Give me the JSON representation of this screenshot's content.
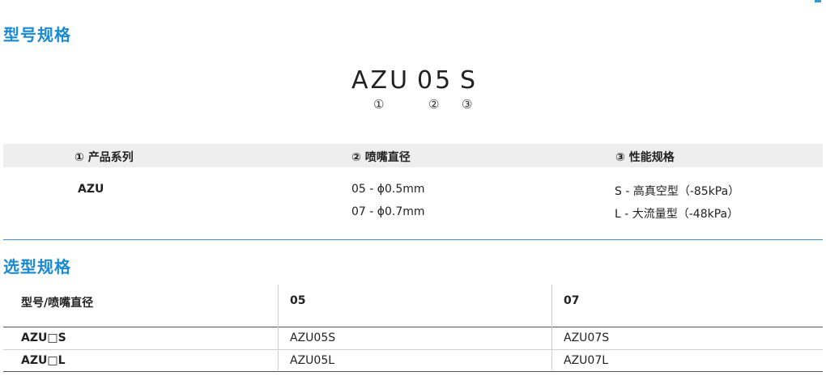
{
  "section1": {
    "title": "型号规格"
  },
  "code": {
    "series": "AZU",
    "diameter": "05",
    "spec": "S",
    "markers": [
      "①",
      "②",
      "③"
    ]
  },
  "spec_table": {
    "headers": [
      "① 产品系列",
      "② 喷嘴直径",
      "③ 性能规格"
    ],
    "series_values": [
      "AZU"
    ],
    "diameter_values": [
      "05 - ϕ0.5mm",
      "07 - ϕ0.7mm"
    ],
    "spec_values": [
      "S - 高真空型（-85kPa）",
      "L - 大流量型（-48kPa）"
    ]
  },
  "section2": {
    "title": "选型规格"
  },
  "select_table": {
    "headers": [
      "型号/喷嘴直径",
      "05",
      "07"
    ],
    "rows": [
      [
        "AZU□S",
        "AZU05S",
        "AZU07S"
      ],
      [
        "AZU□L",
        "AZU05L",
        "AZU07L"
      ]
    ]
  },
  "colors": {
    "accent": "#1a8ad1",
    "rule": "#3a93d0",
    "header_bg": "#eeeeee"
  }
}
